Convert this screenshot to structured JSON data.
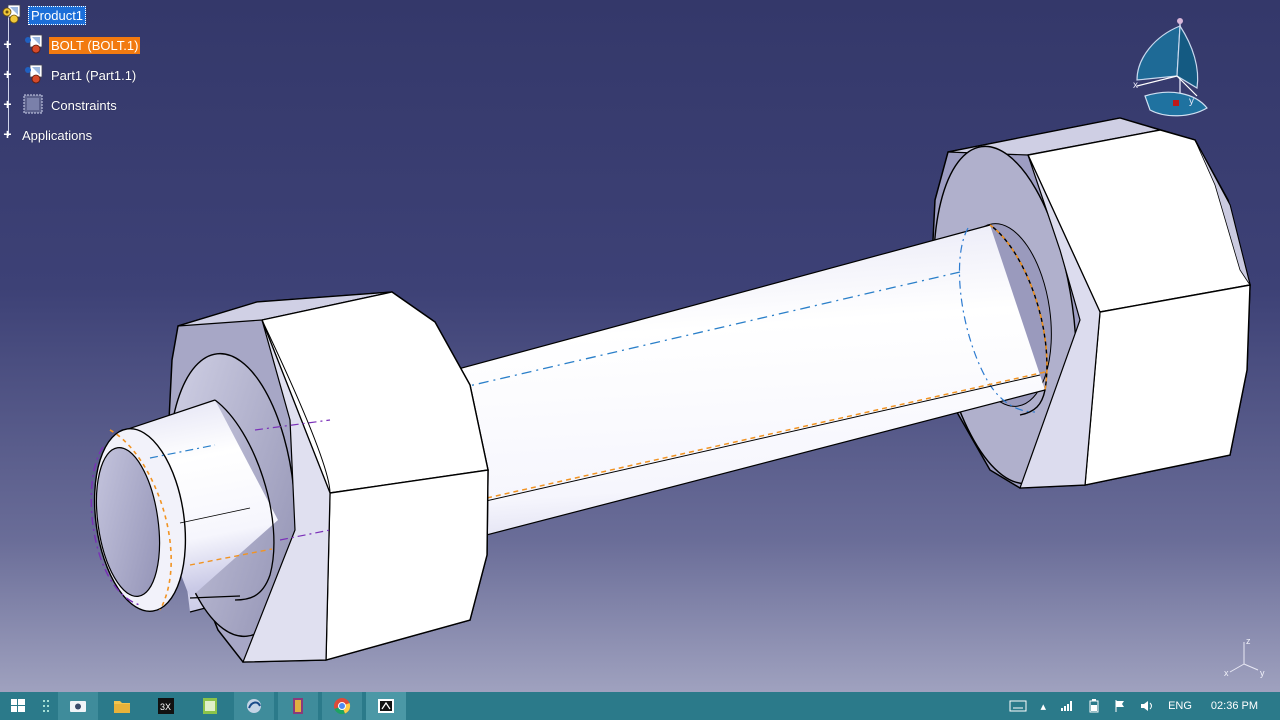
{
  "tree": {
    "root": {
      "label": "Product1"
    },
    "items": [
      {
        "label": "BOLT (BOLT.1)"
      },
      {
        "label": "Part1 (Part1.1)"
      },
      {
        "label": "Constraints"
      },
      {
        "label": "Applications"
      }
    ]
  },
  "compass": {
    "x_label": "x",
    "y_label": "y"
  },
  "axis": {
    "z_label": "z",
    "x_label": "x",
    "y_label": "y"
  },
  "taskbar": {
    "apps": [
      "start-windows",
      "task-view",
      "file-explorer",
      "app-3dx",
      "app-notepad-green",
      "catia-p3",
      "winrar",
      "chrome",
      "catia-active"
    ],
    "tray": {
      "keyboard_icon": "keyboard-icon",
      "language": "ENG",
      "time": "02:36 PM"
    }
  },
  "colors": {
    "background_top": "#34386a",
    "background_bottom": "#a9abc6",
    "selected_blue": "#1c6ed8",
    "highlight_orange": "#f27a10",
    "taskbar": "#2b7a8a"
  }
}
